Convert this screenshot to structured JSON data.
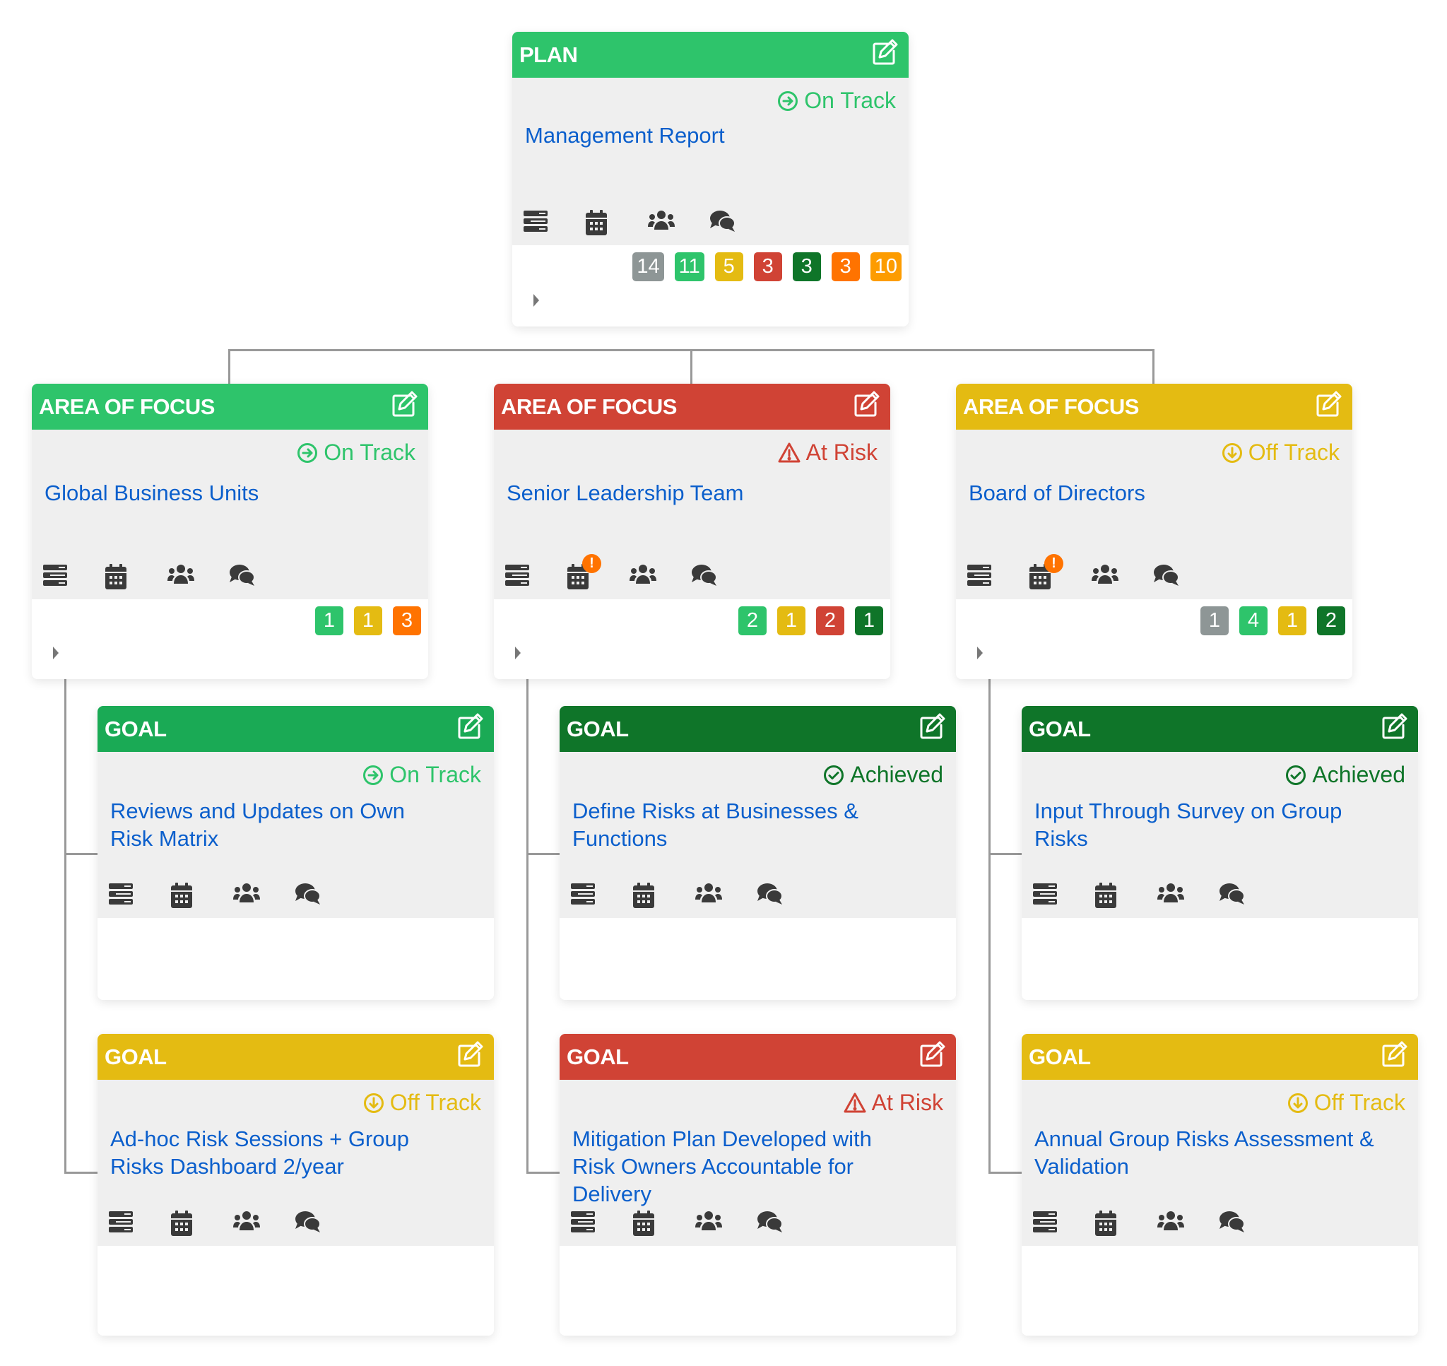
{
  "colors": {
    "green": "#2ec46b",
    "goal_green": "#1aaa55",
    "dark_green": "#0f7529",
    "red": "#d04335",
    "yellow": "#e4bb12",
    "gray": "#8e9696",
    "orange": "#ff7300",
    "amber": "#fd9c00",
    "title_blue": "#0b5fcc",
    "connector": "#999999"
  },
  "status_styles": {
    "On Track": {
      "color": "#2ec46b",
      "icon": "arrow-circle-right-icon"
    },
    "At Risk": {
      "color": "#d04335",
      "icon": "warning-triangle-icon"
    },
    "Off Track": {
      "color": "#e4bb12",
      "icon": "arrow-circle-down-icon"
    },
    "Achieved": {
      "color": "#0f7529",
      "icon": "check-circle-icon"
    }
  },
  "plan": {
    "type_label": "PLAN",
    "header_color": "#2ec46b",
    "status": "On Track",
    "title": "Management Report",
    "calendar_alert": false,
    "badges": [
      {
        "value": "14",
        "color": "#8e9696"
      },
      {
        "value": "11",
        "color": "#2ec46b"
      },
      {
        "value": "5",
        "color": "#e4bb12"
      },
      {
        "value": "3",
        "color": "#d04335"
      },
      {
        "value": "3",
        "color": "#0f7529"
      },
      {
        "value": "3",
        "color": "#ff7300"
      },
      {
        "value": "10",
        "color": "#fd9c00"
      }
    ]
  },
  "areas_of_focus": [
    {
      "type_label": "AREA OF FOCUS",
      "header_color": "#2ec46b",
      "status": "On Track",
      "title": "Global Business Units",
      "calendar_alert": false,
      "badges": [
        {
          "value": "1",
          "color": "#2ec46b"
        },
        {
          "value": "1",
          "color": "#e4bb12"
        },
        {
          "value": "3",
          "color": "#ff7300"
        }
      ],
      "goals": [
        {
          "type_label": "GOAL",
          "header_color": "#1aaa55",
          "status": "On Track",
          "title": "Reviews and Updates on Own Risk Matrix"
        },
        {
          "type_label": "GOAL",
          "header_color": "#e4bb12",
          "status": "Off Track",
          "title": "Ad-hoc Risk Sessions + Group Risks Dashboard 2/year"
        }
      ]
    },
    {
      "type_label": "AREA OF FOCUS",
      "header_color": "#d04335",
      "status": "At Risk",
      "title": "Senior Leadership Team",
      "calendar_alert": true,
      "calendar_alert_symbol": "!",
      "badges": [
        {
          "value": "2",
          "color": "#2ec46b"
        },
        {
          "value": "1",
          "color": "#e4bb12"
        },
        {
          "value": "2",
          "color": "#d04335"
        },
        {
          "value": "1",
          "color": "#0f7529"
        }
      ],
      "goals": [
        {
          "type_label": "GOAL",
          "header_color": "#0f7529",
          "status": "Achieved",
          "title": "Define Risks at Businesses & Functions"
        },
        {
          "type_label": "GOAL",
          "header_color": "#d04335",
          "status": "At Risk",
          "title": "Mitigation Plan Developed with Risk Owners Accountable for Delivery"
        }
      ]
    },
    {
      "type_label": "AREA OF FOCUS",
      "header_color": "#e4bb12",
      "status": "Off Track",
      "title": "Board of Directors",
      "calendar_alert": true,
      "calendar_alert_symbol": "!",
      "badges": [
        {
          "value": "1",
          "color": "#8e9696"
        },
        {
          "value": "4",
          "color": "#2ec46b"
        },
        {
          "value": "1",
          "color": "#e4bb12"
        },
        {
          "value": "2",
          "color": "#0f7529"
        }
      ],
      "goals": [
        {
          "type_label": "GOAL",
          "header_color": "#0f7529",
          "status": "Achieved",
          "title": "Input Through Survey on Group Risks"
        },
        {
          "type_label": "GOAL",
          "header_color": "#e4bb12",
          "status": "Off Track",
          "title": "Annual Group Risks Assessment & Validation"
        }
      ]
    }
  ],
  "card_tool_icons": [
    "details-list-icon",
    "calendar-icon",
    "team-icon",
    "comments-icon"
  ]
}
